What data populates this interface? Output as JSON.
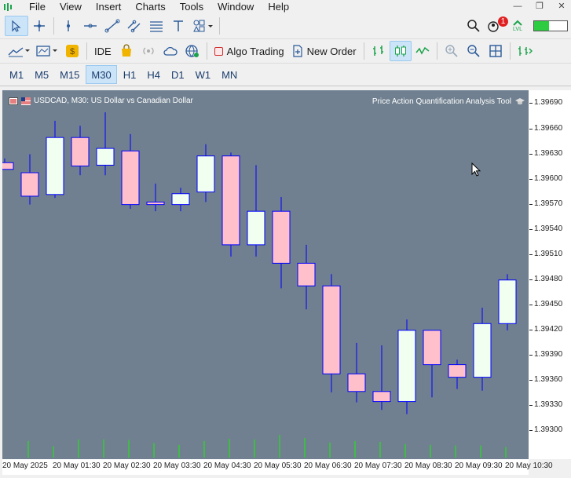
{
  "menu": {
    "items": [
      "File",
      "View",
      "Insert",
      "Charts",
      "Tools",
      "Window",
      "Help"
    ]
  },
  "toolbar2": {
    "ide_label": "IDE",
    "algo_label": "Algo Trading",
    "new_order_label": "New Order",
    "notification_count": "1",
    "lvl_label": "LVL"
  },
  "timeframes": [
    "M1",
    "M5",
    "M15",
    "M30",
    "H1",
    "H4",
    "D1",
    "W1",
    "MN"
  ],
  "active_timeframe": "M30",
  "chart": {
    "symbol_label": "USDCAD, M30:  US Dollar vs Canadian Dollar",
    "indicator_label": "Price Action Quantification Analysis Tool",
    "colors": {
      "background": "#708090",
      "bull_fill": "#f0fff0",
      "bear_fill": "#ffc0cb",
      "border": "#0000ff",
      "volume": "#32cd32"
    }
  },
  "chart_data": {
    "type": "candlestick",
    "ylim": [
      1.39285,
      1.39697
    ],
    "y_ticks": [
      "1.39690",
      "1.39660",
      "1.39630",
      "1.39600",
      "1.39570",
      "1.39540",
      "1.39510",
      "1.39480",
      "1.39450",
      "1.39420",
      "1.39390",
      "1.39360",
      "1.39330",
      "1.39300"
    ],
    "x_ticks": [
      "20 May 2025",
      "20 May 01:30",
      "20 May 02:30",
      "20 May 03:30",
      "20 May 04:30",
      "20 May 05:30",
      "20 May 06:30",
      "20 May 07:30",
      "20 May 08:30",
      "20 May 09:30",
      "20 May 10:30"
    ],
    "candles": [
      {
        "o": 1.3962,
        "h": 1.39625,
        "l": 1.39612,
        "c": 1.39612
      },
      {
        "o": 1.39608,
        "h": 1.3963,
        "l": 1.3957,
        "c": 1.3958
      },
      {
        "o": 1.39582,
        "h": 1.3967,
        "l": 1.39578,
        "c": 1.3965
      },
      {
        "o": 1.3965,
        "h": 1.39664,
        "l": 1.39605,
        "c": 1.39616
      },
      {
        "o": 1.39617,
        "h": 1.3968,
        "l": 1.39605,
        "c": 1.39637
      },
      {
        "o": 1.39634,
        "h": 1.39654,
        "l": 1.39565,
        "c": 1.3957
      },
      {
        "o": 1.39573,
        "h": 1.39595,
        "l": 1.39562,
        "c": 1.3957
      },
      {
        "o": 1.3957,
        "h": 1.3959,
        "l": 1.39562,
        "c": 1.39583
      },
      {
        "o": 1.39585,
        "h": 1.39642,
        "l": 1.39573,
        "c": 1.39628
      },
      {
        "o": 1.39628,
        "h": 1.39632,
        "l": 1.39508,
        "c": 1.39522
      },
      {
        "o": 1.39522,
        "h": 1.39617,
        "l": 1.39508,
        "c": 1.39562
      },
      {
        "o": 1.39562,
        "h": 1.39579,
        "l": 1.3947,
        "c": 1.395
      },
      {
        "o": 1.395,
        "h": 1.39522,
        "l": 1.39445,
        "c": 1.39473
      },
      {
        "o": 1.39473,
        "h": 1.39487,
        "l": 1.39346,
        "c": 1.39368
      },
      {
        "o": 1.39368,
        "h": 1.39405,
        "l": 1.39334,
        "c": 1.39347
      },
      {
        "o": 1.39347,
        "h": 1.39402,
        "l": 1.39325,
        "c": 1.39335
      },
      {
        "o": 1.39335,
        "h": 1.39433,
        "l": 1.3932,
        "c": 1.3942
      },
      {
        "o": 1.3942,
        "h": 1.3942,
        "l": 1.3934,
        "c": 1.39379
      },
      {
        "o": 1.39379,
        "h": 1.39385,
        "l": 1.3935,
        "c": 1.39364
      },
      {
        "o": 1.39364,
        "h": 1.39447,
        "l": 1.39348,
        "c": 1.39428
      },
      {
        "o": 1.39428,
        "h": 1.39487,
        "l": 1.3942,
        "c": 1.3948
      }
    ],
    "volumes": [
      0.55,
      0.38,
      0.6,
      0.6,
      0.58,
      0.48,
      0.42,
      0.55,
      0.62,
      0.6,
      0.75,
      0.65,
      0.5,
      0.55,
      0.52,
      0.45,
      0.42,
      0.4,
      0.4,
      0.35,
      0.32
    ]
  }
}
